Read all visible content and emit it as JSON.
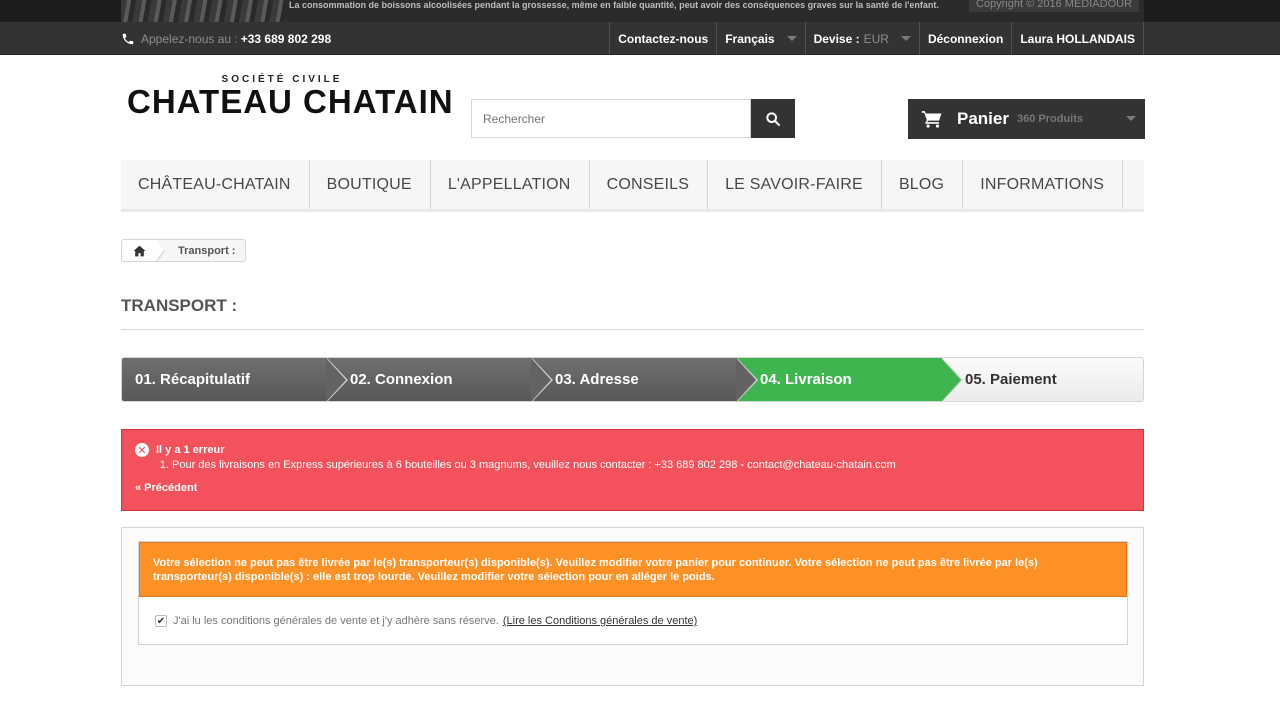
{
  "warning_banner": {
    "text": "La consommation de boissons alcoolisées pendant la grossesse, même en faible quantité, peut avoir des conséquences graves sur la santé de l'enfant.",
    "copyright": "Copyright © 2016 MEDIADOUR"
  },
  "topbar": {
    "phone_label": "Appelez-nous au :",
    "phone_number": "+33 689 802 298",
    "contact": "Contactez-nous",
    "language": "Français",
    "currency_label": "Devise :",
    "currency_value": "EUR",
    "logout": "Déconnexion",
    "user": "Laura HOLLANDAIS"
  },
  "header": {
    "logo_sub": "SOCIÉTÉ CIVILE",
    "logo_main": "CHATEAU CHATAIN",
    "search_placeholder": "Rechercher",
    "cart_label": "Panier",
    "cart_count": "360 Produits"
  },
  "nav": [
    {
      "label": "CHÂTEAU-CHATAIN"
    },
    {
      "label": "BOUTIQUE"
    },
    {
      "label": "L'APPELLATION"
    },
    {
      "label": "CONSEILS"
    },
    {
      "label": "LE SAVOIR-FAIRE"
    },
    {
      "label": "BLOG"
    },
    {
      "label": "INFORMATIONS"
    }
  ],
  "breadcrumb": {
    "current": "Transport :"
  },
  "page_title": "TRANSPORT :",
  "steps": [
    {
      "label": "01. Récapitulatif",
      "state": "done"
    },
    {
      "label": "02. Connexion",
      "state": "done"
    },
    {
      "label": "03. Adresse",
      "state": "done"
    },
    {
      "label": "04. Livraison",
      "state": "current"
    },
    {
      "label": "05. Paiement",
      "state": "todo"
    }
  ],
  "error": {
    "title": "Il y a 1 erreur",
    "items": [
      "Pour des livraisons en Express supérieures à 6 bouteilles ou 3 magnums, veuillez nous contacter : +33 689 802 298 - contact@chateau-chatain.com"
    ],
    "back": "« Précédent"
  },
  "delivery": {
    "warning": "Votre sélection ne peut pas être livrée par le(s) transporteur(s) disponible(s). Veuillez modifier votre panier pour continuer. Votre sélection ne peut pas être livrée par le(s) transporteur(s) disponible(s) : elle est trop lourde. Veuillez modifier votre sélection pour en alléger le poids.",
    "cgv_text": "J'ai lu les conditions générales de vente et j'y adhère sans réserve.",
    "cgv_link": "(Lire les Conditions générales de vente)",
    "cgv_checked": true
  },
  "colors": {
    "dark_bar": "#333333",
    "step_current": "#3fb54f",
    "error_bg": "#f3515c",
    "warning_bg": "#fe9126"
  }
}
